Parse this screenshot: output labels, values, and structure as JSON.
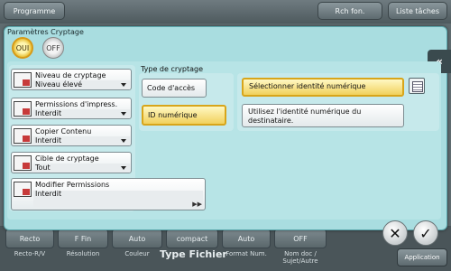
{
  "topbar": {
    "programme_label": "Programme",
    "rch_label": "Rch fon.",
    "liste_label": "Liste tâches"
  },
  "dialog": {
    "title": "Paramètres Cryptage",
    "toggle_on": "OUI",
    "toggle_off": "OFF",
    "side_tab_icon": "double-chevron-left"
  },
  "settings": [
    {
      "label": "Niveau de cryptage",
      "value": "Niveau élevé"
    },
    {
      "label": "Permissions d'impress.",
      "value": "Interdit"
    },
    {
      "label": "Copier Contenu",
      "value": "Interdit"
    },
    {
      "label": "Cible de cryptage",
      "value": "Tout"
    },
    {
      "label": "Modifier Permissions",
      "value": "Interdit"
    }
  ],
  "crypt_type": {
    "title": "Type de cryptage",
    "options": [
      "Code d'accès",
      "ID numérique"
    ],
    "selected": "ID numérique"
  },
  "digital_id": {
    "select_label": "Sélectionner identité numérique",
    "use_label": "Utilisez l'identité numérique du destinataire."
  },
  "bottom": {
    "cells": [
      "Recto",
      "F Fin",
      "Auto",
      "compact",
      "Auto",
      "OFF"
    ],
    "captions": [
      "Recto-R/V",
      "Résolution",
      "Couleur",
      "Format Num.",
      "Nom doc / Sujet/Autre"
    ],
    "type_fichier": "Type Fichier",
    "application": "Application"
  },
  "actions": {
    "cancel_icon": "close-icon",
    "ok_icon": "check-icon"
  }
}
